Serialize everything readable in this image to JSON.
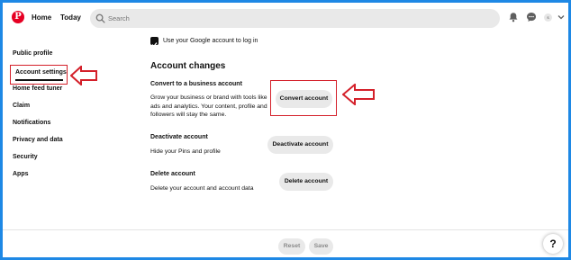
{
  "header": {
    "logo_letter": "P",
    "nav": [
      "Home",
      "Today"
    ],
    "search_placeholder": "Search",
    "avatar_letter": "s"
  },
  "sidebar": {
    "items": [
      {
        "label": "Public profile"
      },
      {
        "label": "Account settings",
        "active": true
      },
      {
        "label": "Home feed tuner"
      },
      {
        "label": "Claim"
      },
      {
        "label": "Notifications"
      },
      {
        "label": "Privacy and data"
      },
      {
        "label": "Security"
      },
      {
        "label": "Apps"
      }
    ]
  },
  "main": {
    "google_login_label": "Use your Google account to log in",
    "google_login_checked": true,
    "section_title": "Account changes",
    "convert": {
      "title": "Convert to a business account",
      "description": "Grow your business or brand with tools like ads and analytics. Your content, profile and followers will stay the same.",
      "button": "Convert account"
    },
    "deactivate": {
      "title": "Deactivate account",
      "description": "Hide your Pins and profile",
      "button": "Deactivate account"
    },
    "delete": {
      "title": "Delete account",
      "description": "Delete your account and account data",
      "button": "Delete account"
    }
  },
  "footer": {
    "reset_label": "Reset",
    "save_label": "Save",
    "help_label": "?"
  },
  "colors": {
    "accent_blue": "#1e88e5",
    "annotation_red": "#d4202a",
    "brand_red": "#e60023",
    "button_gray": "#e9e9e9"
  }
}
